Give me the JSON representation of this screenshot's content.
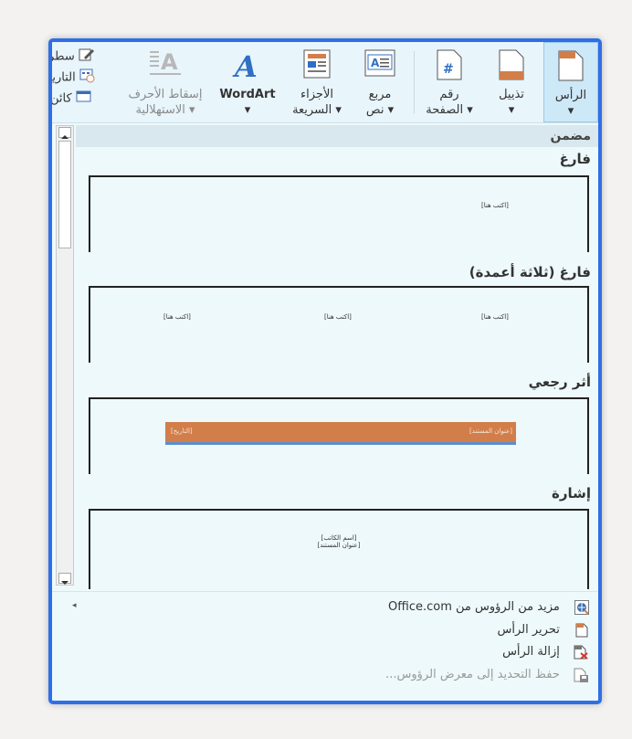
{
  "ribbon": {
    "header_btn": {
      "l1": "الرأس",
      "l2": "▾"
    },
    "footer_btn": {
      "l1": "تذييل",
      "l2": "▾"
    },
    "pagenum_btn": {
      "l1": "رقم",
      "l2": "الصفحة ▾"
    },
    "textbox_btn": {
      "l1": "مربع",
      "l2": "نص ▾"
    },
    "quickparts_btn": {
      "l1": "الأجزاء",
      "l2": "السريعة ▾"
    },
    "wordart_btn": {
      "l1": "WordArt",
      "l2": "▾"
    },
    "dropcap_btn": {
      "l1": "إسقاط الأحرف",
      "l2": "الاستهلالية ▾"
    },
    "small_right": [
      "سطر",
      "التاريخ",
      "كائن"
    ]
  },
  "gallery": {
    "section_header": "مضمن",
    "items": [
      {
        "title": "فارغ",
        "placeholders": [
          "[اكتب هنا]"
        ]
      },
      {
        "title": "فارغ (ثلاثة أعمدة)",
        "placeholders": [
          "[اكتب هنا]",
          "[اكتب هنا]",
          "[اكتب هنا]"
        ]
      },
      {
        "title": "أثر رجعي",
        "placeholders": [
          "[عنوان المستند]",
          "[التاريخ]"
        ]
      },
      {
        "title": "إشارة",
        "placeholders": [
          "[اسم الكاتب]",
          "[عنوان المستند]"
        ]
      }
    ]
  },
  "menu": {
    "more_headers": "مزيد من الرؤوس من Office.com",
    "edit_header": "تحرير الرأس",
    "remove_header": "إزالة الرأس",
    "save_selection": "حفظ التحديد إلى معرض الرؤوس..."
  },
  "colors": {
    "accent_border": "#2f6fe6",
    "banner": "#d27e4b",
    "banner_rule": "#5b8fd0"
  }
}
